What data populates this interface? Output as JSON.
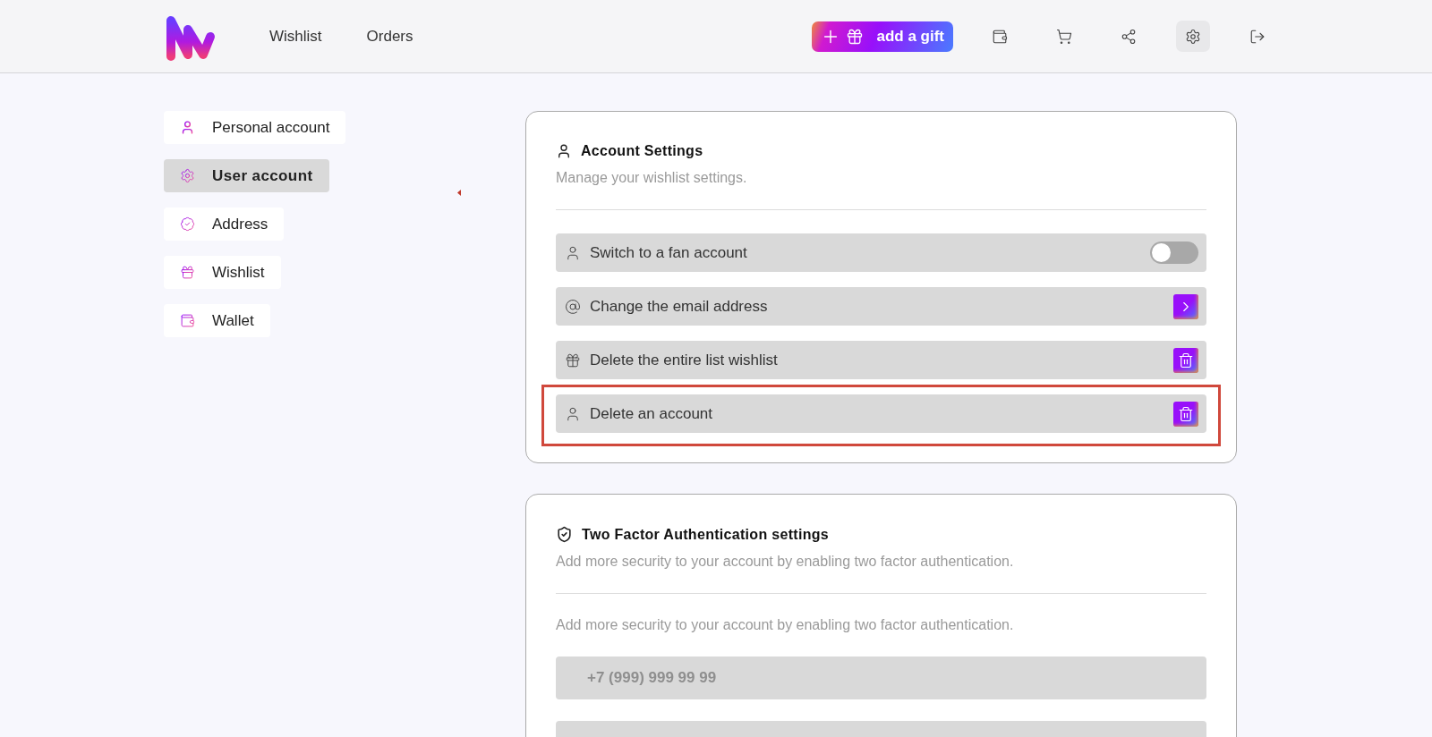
{
  "header": {
    "nav": [
      "Wishlist",
      "Orders"
    ],
    "add_button": "add a gift",
    "toolbar": [
      {
        "kind": "wallet",
        "selected": false
      },
      {
        "kind": "cart",
        "selected": false
      },
      {
        "kind": "share",
        "selected": false
      },
      {
        "kind": "settings",
        "selected": true
      },
      {
        "kind": "logout",
        "selected": false
      }
    ]
  },
  "sidebar": {
    "items": [
      {
        "label": "Personal account",
        "kind": "user",
        "selected": false
      },
      {
        "label": "User account",
        "kind": "settings",
        "selected": true
      },
      {
        "label": "Address",
        "kind": "badge",
        "selected": false
      },
      {
        "label": "Wishlist",
        "kind": "gift",
        "selected": false
      },
      {
        "label": "Wallet",
        "kind": "wallet",
        "selected": false
      }
    ]
  },
  "account_settings": {
    "title": "Account Settings",
    "subtitle": "Manage your wishlist settings.",
    "rows": [
      {
        "label": "Switch to a fan account",
        "kind": "toggle",
        "on": false,
        "highlighted": false
      },
      {
        "label": "Change the email address",
        "kind": "arrow",
        "highlighted": false
      },
      {
        "label": "Delete the entire list wishlist",
        "kind": "delete",
        "highlighted": false
      },
      {
        "label": "Delete an account",
        "kind": "delete",
        "highlighted": true
      }
    ]
  },
  "two_factor": {
    "title": "Two Factor Authentication settings",
    "subtitle": "Add more security to your account by enabling two factor authentication.",
    "description": "Add more security to your account by enabling two factor authentication.",
    "fields": [
      {
        "kind": "phone",
        "placeholder": "+7 (999) 999 99 99"
      },
      {
        "kind": "blank"
      }
    ]
  }
}
